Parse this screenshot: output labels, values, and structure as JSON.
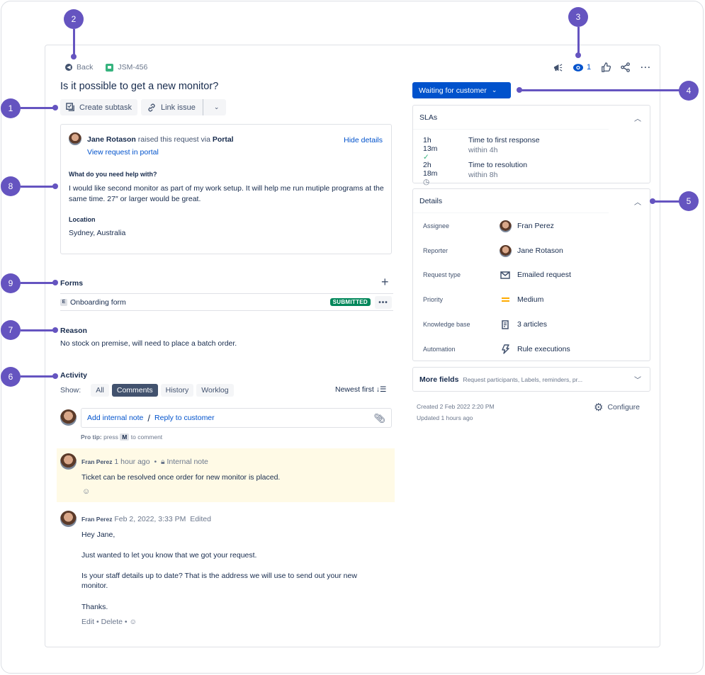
{
  "header": {
    "back_label": "Back",
    "issue_key": "JSM-456",
    "title": "Is it possible to get a new monitor?",
    "toolbar": {
      "create_subtask": "Create subtask",
      "link_issue": "Link issue"
    },
    "actions": {
      "watch_count": "1"
    }
  },
  "request": {
    "reporter": "Jane Rotason",
    "raised_text": "raised this request via",
    "channel": "Portal",
    "view_link": "View request in portal",
    "hide_details": "Hide details",
    "question_label": "What do you need help with?",
    "question_answer": "I would like second monitor as part of my work setup. It will help me run mutiple programs at the same time. 27″ or larger would be great.",
    "location_label": "Location",
    "location_value": "Sydney, Australia"
  },
  "forms": {
    "heading": "Forms",
    "items": [
      {
        "badge_letter": "E",
        "name": "Onboarding form",
        "status": "SUBMITTED",
        "status_color": "#00875a"
      }
    ]
  },
  "reason": {
    "heading": "Reason",
    "value": "No stock on premise, will need to place a batch order."
  },
  "activity": {
    "heading": "Activity",
    "show_label": "Show:",
    "filters": [
      "All",
      "Comments",
      "History",
      "Worklog"
    ],
    "active_filter": "Comments",
    "sort_label": "Newest first",
    "input": {
      "internal_note": "Add internal note",
      "separator": "/",
      "reply": "Reply to customer"
    },
    "protip_prefix": "Pro tip:",
    "protip_press": "press",
    "protip_key": "M",
    "protip_suffix": "to comment",
    "comments": [
      {
        "author": "Fran Perez",
        "time": "1 hour ago",
        "bullet": "•",
        "visibility": "Internal note",
        "body": "Ticket can be resolved once order for new monitor is placed.",
        "background": "#fffae6"
      },
      {
        "author": "Fran Perez",
        "time": "Feb 2, 2022, 3:33 PM",
        "edited": "Edited",
        "body_lines": [
          "Hey Jane,",
          "Just wanted to let you know that we got your request.",
          "Is your staff details up to date? That is the address we will use to send out your new monitor.",
          "Thanks."
        ],
        "actions": [
          "Edit",
          "Delete"
        ],
        "bullet": "•"
      }
    ]
  },
  "sidebar": {
    "status": "Waiting for customer",
    "status_color": "#0052cc",
    "slas": {
      "heading": "SLAs",
      "items": [
        {
          "time": "1h 13m",
          "name": "Time to first response",
          "target": "within 4h",
          "state": "met"
        },
        {
          "time": "2h 18m",
          "name": "Time to resolution",
          "target": "within 8h",
          "state": "running"
        }
      ]
    },
    "details": {
      "heading": "Details",
      "rows": [
        {
          "label": "Assignee",
          "value": "Fran Perez",
          "icon": "avatar"
        },
        {
          "label": "Reporter",
          "value": "Jane Rotason",
          "icon": "avatar"
        },
        {
          "label": "Request type",
          "value": "Emailed request",
          "icon": "mail-icon"
        },
        {
          "label": "Priority",
          "value": "Medium",
          "icon": "priority-medium-icon"
        },
        {
          "label": "Knowledge base",
          "value": "3 articles",
          "icon": "document-icon"
        },
        {
          "label": "Automation",
          "value": "Rule executions",
          "icon": "lightning-icon"
        }
      ]
    },
    "more_fields": {
      "label": "More fields",
      "summary": "Request participants, Labels, reminders, pr..."
    },
    "created": "Created 2 Feb 2022 2:20 PM",
    "updated": "Updated 1 hours ago",
    "configure": "Configure"
  },
  "annotations": [
    "1",
    "2",
    "3",
    "4",
    "5",
    "6",
    "7",
    "8",
    "9"
  ]
}
